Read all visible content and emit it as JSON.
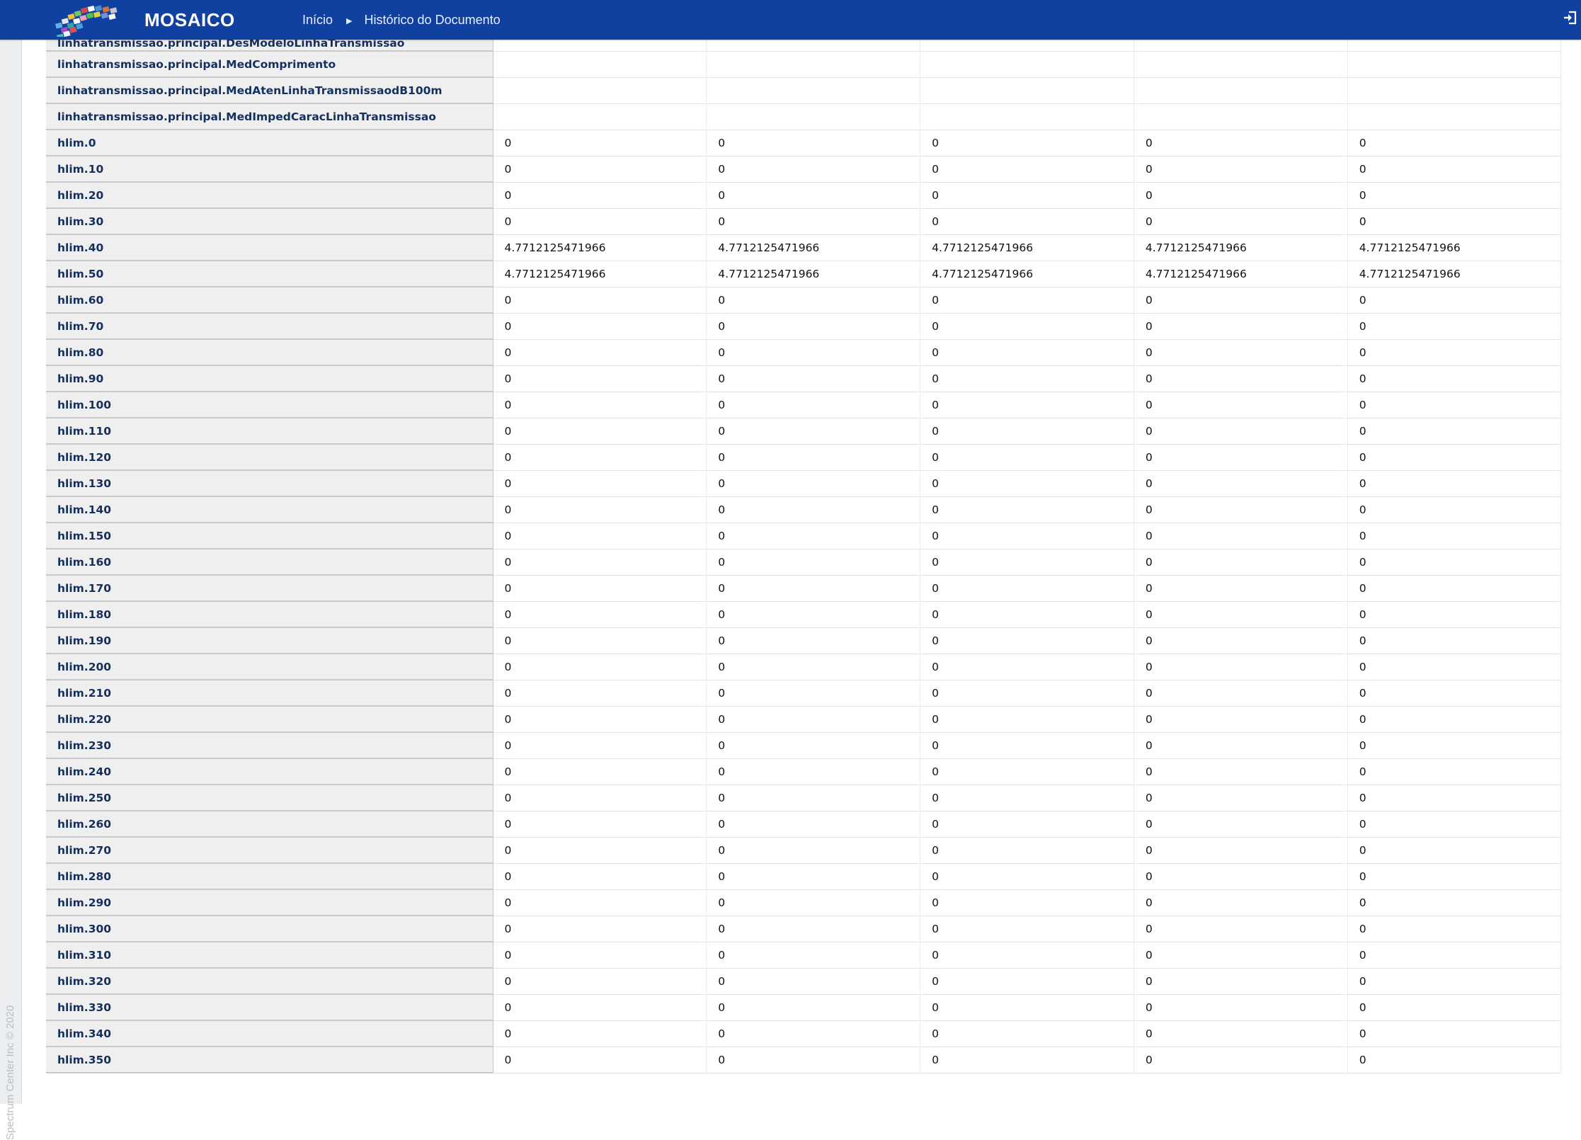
{
  "header": {
    "brand": "MOSAICO",
    "breadcrumb_home": "Início",
    "breadcrumb_current": "Histórico do Documento",
    "logo_icon": "mosaic-logo-icon",
    "logout_icon": "sign-out-icon",
    "background_color": "#1040a0"
  },
  "sidebar": {
    "copyright": "Spectrum Center Inc © 2020"
  },
  "table": {
    "rows": [
      {
        "key": "linhatransmissao.principal.DesModeloLinhaTransmissao",
        "values": [
          "",
          "",
          "",
          "",
          ""
        ]
      },
      {
        "key": "linhatransmissao.principal.MedComprimento",
        "values": [
          "",
          "",
          "",
          "",
          ""
        ]
      },
      {
        "key": "linhatransmissao.principal.MedAtenLinhaTransmissaodB100m",
        "values": [
          "",
          "",
          "",
          "",
          ""
        ]
      },
      {
        "key": "linhatransmissao.principal.MedImpedCaracLinhaTransmissao",
        "values": [
          "",
          "",
          "",
          "",
          ""
        ]
      },
      {
        "key": "hlim.0",
        "values": [
          "0",
          "0",
          "0",
          "0",
          "0"
        ]
      },
      {
        "key": "hlim.10",
        "values": [
          "0",
          "0",
          "0",
          "0",
          "0"
        ]
      },
      {
        "key": "hlim.20",
        "values": [
          "0",
          "0",
          "0",
          "0",
          "0"
        ]
      },
      {
        "key": "hlim.30",
        "values": [
          "0",
          "0",
          "0",
          "0",
          "0"
        ]
      },
      {
        "key": "hlim.40",
        "values": [
          "4.7712125471966",
          "4.7712125471966",
          "4.7712125471966",
          "4.7712125471966",
          "4.7712125471966"
        ]
      },
      {
        "key": "hlim.50",
        "values": [
          "4.7712125471966",
          "4.7712125471966",
          "4.7712125471966",
          "4.7712125471966",
          "4.7712125471966"
        ]
      },
      {
        "key": "hlim.60",
        "values": [
          "0",
          "0",
          "0",
          "0",
          "0"
        ]
      },
      {
        "key": "hlim.70",
        "values": [
          "0",
          "0",
          "0",
          "0",
          "0"
        ]
      },
      {
        "key": "hlim.80",
        "values": [
          "0",
          "0",
          "0",
          "0",
          "0"
        ]
      },
      {
        "key": "hlim.90",
        "values": [
          "0",
          "0",
          "0",
          "0",
          "0"
        ]
      },
      {
        "key": "hlim.100",
        "values": [
          "0",
          "0",
          "0",
          "0",
          "0"
        ]
      },
      {
        "key": "hlim.110",
        "values": [
          "0",
          "0",
          "0",
          "0",
          "0"
        ]
      },
      {
        "key": "hlim.120",
        "values": [
          "0",
          "0",
          "0",
          "0",
          "0"
        ]
      },
      {
        "key": "hlim.130",
        "values": [
          "0",
          "0",
          "0",
          "0",
          "0"
        ]
      },
      {
        "key": "hlim.140",
        "values": [
          "0",
          "0",
          "0",
          "0",
          "0"
        ]
      },
      {
        "key": "hlim.150",
        "values": [
          "0",
          "0",
          "0",
          "0",
          "0"
        ]
      },
      {
        "key": "hlim.160",
        "values": [
          "0",
          "0",
          "0",
          "0",
          "0"
        ]
      },
      {
        "key": "hlim.170",
        "values": [
          "0",
          "0",
          "0",
          "0",
          "0"
        ]
      },
      {
        "key": "hlim.180",
        "values": [
          "0",
          "0",
          "0",
          "0",
          "0"
        ]
      },
      {
        "key": "hlim.190",
        "values": [
          "0",
          "0",
          "0",
          "0",
          "0"
        ]
      },
      {
        "key": "hlim.200",
        "values": [
          "0",
          "0",
          "0",
          "0",
          "0"
        ]
      },
      {
        "key": "hlim.210",
        "values": [
          "0",
          "0",
          "0",
          "0",
          "0"
        ]
      },
      {
        "key": "hlim.220",
        "values": [
          "0",
          "0",
          "0",
          "0",
          "0"
        ]
      },
      {
        "key": "hlim.230",
        "values": [
          "0",
          "0",
          "0",
          "0",
          "0"
        ]
      },
      {
        "key": "hlim.240",
        "values": [
          "0",
          "0",
          "0",
          "0",
          "0"
        ]
      },
      {
        "key": "hlim.250",
        "values": [
          "0",
          "0",
          "0",
          "0",
          "0"
        ]
      },
      {
        "key": "hlim.260",
        "values": [
          "0",
          "0",
          "0",
          "0",
          "0"
        ]
      },
      {
        "key": "hlim.270",
        "values": [
          "0",
          "0",
          "0",
          "0",
          "0"
        ]
      },
      {
        "key": "hlim.280",
        "values": [
          "0",
          "0",
          "0",
          "0",
          "0"
        ]
      },
      {
        "key": "hlim.290",
        "values": [
          "0",
          "0",
          "0",
          "0",
          "0"
        ]
      },
      {
        "key": "hlim.300",
        "values": [
          "0",
          "0",
          "0",
          "0",
          "0"
        ]
      },
      {
        "key": "hlim.310",
        "values": [
          "0",
          "0",
          "0",
          "0",
          "0"
        ]
      },
      {
        "key": "hlim.320",
        "values": [
          "0",
          "0",
          "0",
          "0",
          "0"
        ]
      },
      {
        "key": "hlim.330",
        "values": [
          "0",
          "0",
          "0",
          "0",
          "0"
        ]
      },
      {
        "key": "hlim.340",
        "values": [
          "0",
          "0",
          "0",
          "0",
          "0"
        ]
      },
      {
        "key": "hlim.350",
        "values": [
          "0",
          "0",
          "0",
          "0",
          "0"
        ]
      }
    ]
  }
}
